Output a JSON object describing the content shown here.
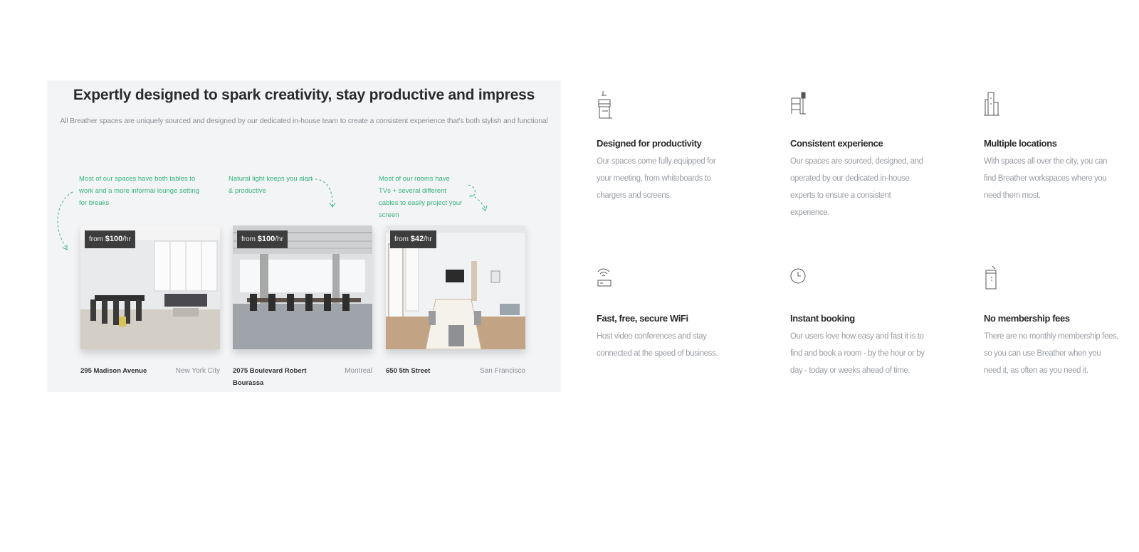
{
  "panel": {
    "title": "Expertly designed to spark creativity, stay productive and impress",
    "subtitle": "All Breather spaces are uniquely sourced and designed by our dedicated in-house team to create a consistent experience that's both stylish and functional",
    "notes": [
      "Most of our spaces have both tables to work and a more informal lounge setting for breaks",
      "Natural light keeps you alert & productive",
      "Most of our rooms have TVs + several different cables to easily project your screen"
    ],
    "spaces": [
      {
        "price_prefix": "from",
        "price": "$100",
        "price_suffix": "/hr",
        "address": "295 Madison Avenue",
        "city": "New York City"
      },
      {
        "price_prefix": "from",
        "price": "$100",
        "price_suffix": "/hr",
        "address": "2075 Boulevard Robert Bourassa",
        "city": "Montreal"
      },
      {
        "price_prefix": "from",
        "price": "$42",
        "price_suffix": "/hr",
        "address": "650 5th Street",
        "city": "San Francisco"
      }
    ]
  },
  "features": [
    {
      "icon": "desk-chair-icon",
      "title": "Designed for productivity",
      "description": "Our spaces come fully equipped for your meeting, from whiteboards to chargers and screens."
    },
    {
      "icon": "chair-lamp-icon",
      "title": "Consistent experience",
      "description": "Our spaces are sourced, designed, and operated by our dedicated in-house experts to ensure a consistent experience."
    },
    {
      "icon": "buildings-icon",
      "title": "Multiple locations",
      "description": "With spaces all over the city, you can find Breather workspaces where you need them most."
    },
    {
      "icon": "wifi-router-icon",
      "title": "Fast, free, secure WiFi",
      "description": "Host video conferences and stay connected at the speed of business."
    },
    {
      "icon": "clock-icon",
      "title": "Instant booking",
      "description": "Our users love how easy and fast it is to find and book a room - by the hour or by day - today or weeks ahead of time."
    },
    {
      "icon": "coffee-cup-icon",
      "title": "No membership fees",
      "description": "There are no monthly membership fees, so you can use Breather when you need it, as often as you need it."
    }
  ],
  "colors": {
    "accent": "#36b37e",
    "panel_bg": "#f3f4f6",
    "tag_bg": "#3d3d3d"
  }
}
